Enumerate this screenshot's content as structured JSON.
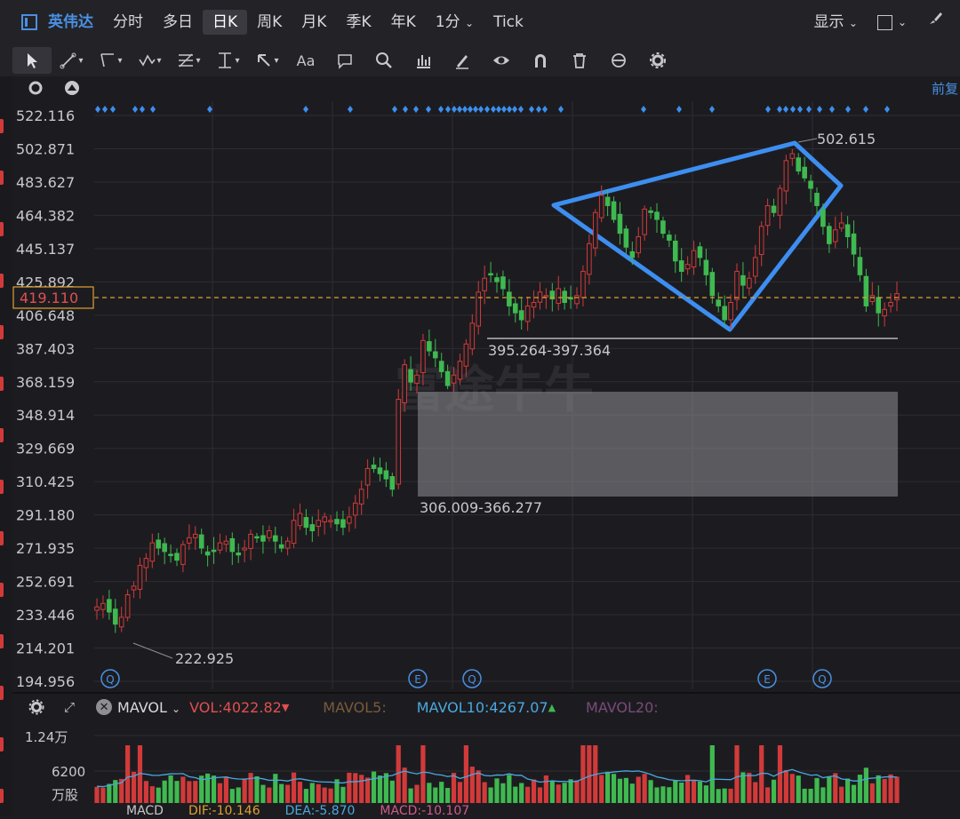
{
  "header": {
    "symbol": "英伟达",
    "tabs": [
      "分时",
      "多日",
      "日K",
      "周K",
      "月K",
      "季K",
      "年K",
      "1分",
      "Tick"
    ],
    "active_tab": "日K",
    "display_label": "显示",
    "fq_label": "前复"
  },
  "colors": {
    "up": "#d23a3a",
    "down": "#3fb950",
    "accent": "#4a90e2",
    "price_line": "#e0a030",
    "ma10": "#4aa8e0"
  },
  "price_axis": {
    "labels": [
      "522.116",
      "502.871",
      "483.627",
      "464.382",
      "445.137",
      "425.892",
      "406.648",
      "387.403",
      "368.159",
      "348.914",
      "329.669",
      "310.425",
      "291.180",
      "271.935",
      "252.691",
      "233.446",
      "214.201",
      "194.956"
    ],
    "current": "419.110"
  },
  "annotations": {
    "high_label": "502.615",
    "low_label": "222.925",
    "line_label": "395.264-397.364",
    "box_label": "306.009-366.277",
    "watermark": "富途牛牛"
  },
  "event_markers": [
    "Q",
    "E",
    "Q",
    "E",
    "Q"
  ],
  "vol_bar": {
    "indicator": "MAVOL",
    "vol": "VOL:4022.82",
    "ma5": "MAVOL5:",
    "ma10": "MAVOL10:4267.07",
    "ma20": "MAVOL20:",
    "axis_top": "1.24万",
    "axis_mid": "6200",
    "axis_unit": "万股"
  },
  "macd_bar": {
    "name": "MACD",
    "dif": "DIF:-10.146",
    "dea": "DEA:-5.870",
    "macd": "MACD:-10.107"
  },
  "chart_data": {
    "type": "candlestick",
    "closes": [
      238,
      240,
      235,
      228,
      232,
      245,
      250,
      262,
      266,
      275,
      272,
      270,
      268,
      265,
      274,
      278,
      280,
      272,
      268,
      270,
      275,
      276,
      270,
      268,
      272,
      280,
      278,
      276,
      282,
      276,
      272,
      276,
      288,
      292,
      284,
      282,
      288,
      290,
      288,
      286,
      284,
      290,
      298,
      306,
      318,
      318,
      315,
      312,
      306,
      358,
      378,
      368,
      372,
      392,
      386,
      382,
      374,
      366,
      372,
      380,
      390,
      402,
      420,
      428,
      430,
      426,
      422,
      412,
      408,
      404,
      412,
      414,
      420,
      418,
      416,
      422,
      414,
      416,
      418,
      432,
      448,
      466,
      476,
      470,
      462,
      454,
      446,
      440,
      452,
      468,
      466,
      462,
      454,
      450,
      438,
      432,
      436,
      444,
      440,
      430,
      418,
      412,
      404,
      414,
      432,
      424,
      428,
      440,
      458,
      470,
      466,
      480,
      496,
      500,
      490,
      486,
      480,
      470,
      458,
      448,
      456,
      460,
      452,
      442,
      430,
      412,
      418,
      408,
      410,
      414,
      419.11
    ],
    "ylim": [
      194.956,
      522.116
    ],
    "high": 502.615,
    "low": 222.925,
    "current": 419.11
  }
}
